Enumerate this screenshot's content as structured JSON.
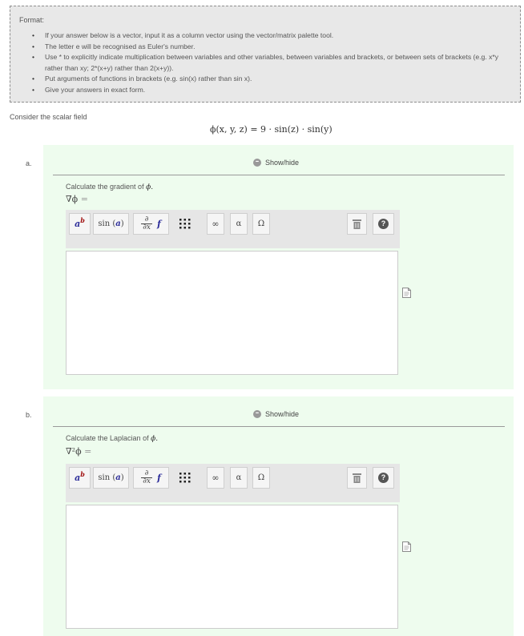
{
  "format": {
    "title": "Format:",
    "items": [
      "If your answer below is a vector, input it as a column vector using the vector/matrix palette tool.",
      "The letter e will be recognised as Euler's number.",
      "Use * to explicitly indicate multiplication between variables and other variables, between variables and brackets, or between sets of brackets (e.g. x*y rather than xy; 2*(x+y) rather than 2(x+y)).",
      "Put arguments of functions in brackets (e.g. sin(x) rather than sin x).",
      "Give your answers in exact form."
    ]
  },
  "intro": "Consider the scalar field",
  "field_formula": "ϕ(x, y, z) = 9 · sin(z) · sin(y)",
  "toolbar": {
    "power": "a^b",
    "sin": "sin (a)",
    "partial_num": "∂",
    "partial_den": "∂x",
    "f": "f",
    "matrix_glyph": "⁙",
    "infinity": "∞",
    "alpha": "α",
    "omega": "Ω",
    "help": "?"
  },
  "parts": [
    {
      "letter": "a.",
      "showhide": "Show/hide",
      "prompt": "Calculate the gradient of",
      "prompt_symbol": "ϕ.",
      "lhs": "∇ϕ",
      "lhs_op": "="
    },
    {
      "letter": "b.",
      "showhide": "Show/hide",
      "prompt": "Calculate the Laplacian of",
      "prompt_symbol": "ϕ.",
      "lhs": "∇²ϕ",
      "lhs_op": "="
    }
  ],
  "colors": {
    "panel_bg": "#eefcee",
    "format_bg": "#e8e8e8",
    "toolbar_bg": "#e6e6e6",
    "power_a": "#2d2d9a",
    "power_b": "#a01010",
    "sin_arg": "#2d2d9a",
    "f_color": "#2d2d9a",
    "help_bg": "#555555"
  }
}
